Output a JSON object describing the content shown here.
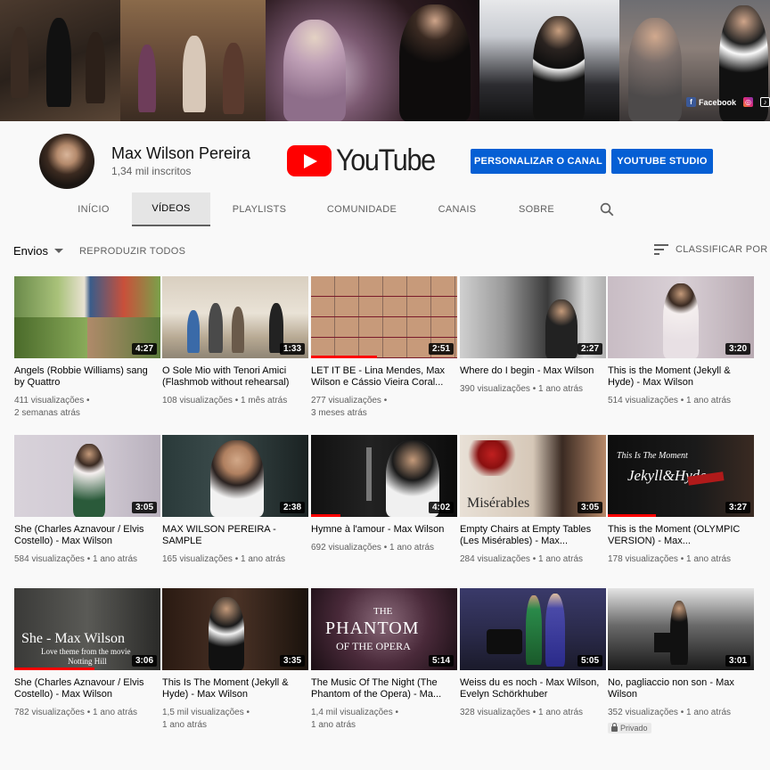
{
  "banner": {
    "social": [
      {
        "icon": "facebook-icon",
        "glyph": "f",
        "label": "Facebook"
      },
      {
        "icon": "instagram-icon",
        "glyph": "◎",
        "label": ""
      },
      {
        "icon": "tiktok-icon",
        "glyph": "♪",
        "label": ""
      }
    ]
  },
  "channel": {
    "name": "Max Wilson Pereira",
    "subscribers": "1,34 mil inscritos",
    "logo_text": "YouTube"
  },
  "buttons": {
    "customize": "PERSONALIZAR O CANAL",
    "studio": "YOUTUBE STUDIO"
  },
  "tabs": [
    {
      "label": "INÍCIO",
      "active": false
    },
    {
      "label": "VÍDEOS",
      "active": true
    },
    {
      "label": "PLAYLISTS",
      "active": false
    },
    {
      "label": "COMUNIDADE",
      "active": false
    },
    {
      "label": "CANAIS",
      "active": false
    },
    {
      "label": "SOBRE",
      "active": false
    }
  ],
  "toolbar": {
    "uploads": "Envios",
    "play_all": "REPRODUZIR TODOS",
    "sort": "CLASSIFICAR POR"
  },
  "videos": [
    {
      "title": "Angels (Robbie Williams) sang by Quattro",
      "views": "411 visualizações",
      "age": "2 semanas atrás",
      "duration": "4:27",
      "progress": 0,
      "private": false
    },
    {
      "title": "O Sole Mio with Tenori Amici (Flashmob without rehearsal)",
      "views": "108 visualizações",
      "age": "1 mês atrás",
      "duration": "1:33",
      "progress": 0,
      "private": false
    },
    {
      "title": "LET IT BE - Lina Mendes, Max Wilson e Cássio Vieira Coral...",
      "views": "277 visualizações",
      "age": "3 meses atrás",
      "duration": "2:51",
      "progress": 0.45,
      "private": false
    },
    {
      "title": "Where do I begin - Max Wilson",
      "views": "390 visualizações",
      "age": "1 ano atrás",
      "duration": "2:27",
      "progress": 0,
      "private": false
    },
    {
      "title": "This is the Moment (Jekyll & Hyde) - Max Wilson",
      "views": "514 visualizações",
      "age": "1 ano atrás",
      "duration": "3:20",
      "progress": 0,
      "private": false
    },
    {
      "title": "She (Charles Aznavour / Elvis Costello) - Max Wilson",
      "views": "584 visualizações",
      "age": "1 ano atrás",
      "duration": "3:05",
      "progress": 0,
      "private": false
    },
    {
      "title": "MAX WILSON PEREIRA - SAMPLE",
      "views": "165 visualizações",
      "age": "1 ano atrás",
      "duration": "2:38",
      "progress": 0,
      "private": false
    },
    {
      "title": "Hymne à l'amour - Max Wilson",
      "views": "692 visualizações",
      "age": "1 ano atrás",
      "duration": "4:02",
      "progress": 0.2,
      "private": false
    },
    {
      "title": "Empty Chairs at Empty Tables (Les Misérables) - Max...",
      "views": "284 visualizações",
      "age": "1 ano atrás",
      "duration": "3:05",
      "progress": 0,
      "private": false
    },
    {
      "title": "This is the Moment (OLYMPIC VERSION) - Max...",
      "views": "178 visualizações",
      "age": "1 ano atrás",
      "duration": "3:27",
      "progress": 0.33,
      "private": false
    },
    {
      "title": "She (Charles Aznavour / Elvis Costello) - Max Wilson",
      "views": "782 visualizações",
      "age": "1 ano atrás",
      "duration": "3:06",
      "progress": 0.55,
      "private": false
    },
    {
      "title": "This Is The Moment (Jekyll & Hyde) - Max Wilson",
      "views": "1,5 mil visualizações",
      "age": "1 ano atrás",
      "duration": "3:35",
      "progress": 0,
      "private": false
    },
    {
      "title": "The Music Of The Night (The Phantom of the Opera) - Ma...",
      "views": "1,4 mil visualizações",
      "age": "1 ano atrás",
      "duration": "5:14",
      "progress": 0,
      "private": false
    },
    {
      "title": "Weiss du es noch - Max Wilson, Evelyn Schörkhuber",
      "views": "328 visualizações",
      "age": "1 ano atrás",
      "duration": "5:05",
      "progress": 0,
      "private": false
    },
    {
      "title": "No, pagliaccio non son - Max Wilson",
      "views": "352 visualizações",
      "age": "1 ano atrás",
      "duration": "3:01",
      "progress": 0,
      "private": true,
      "private_label": "Privado"
    }
  ],
  "thumb_text": {
    "she_title": "She - Max Wilson",
    "she_sub1": "Love theme from the movie",
    "she_sub2": "Notting Hill",
    "phantom1": "THE",
    "phantom2": "PHANTOM",
    "phantom3": "OF THE OPERA",
    "moment": "This Is The Moment",
    "jekyll": "Jekyll&Hyde",
    "mis": "Misérables"
  },
  "colors": {
    "accent_blue": "#065fd4",
    "youtube_red": "#ff0000"
  }
}
